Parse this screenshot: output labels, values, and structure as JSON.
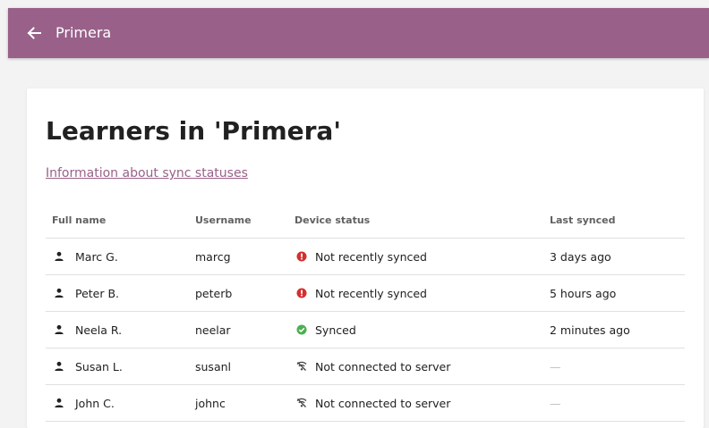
{
  "appbar": {
    "title": "Primera",
    "background": "#996189",
    "back_icon": "arrow-left-icon"
  },
  "page": {
    "title": "Learners in 'Primera'",
    "info_link": "Information about sync statuses"
  },
  "table": {
    "headers": [
      "Full name",
      "Username",
      "Device status",
      "Last synced"
    ],
    "rows": [
      {
        "full_name": "Marc G.",
        "username": "marcg",
        "status": "Not recently synced",
        "status_icon": "error-icon",
        "last_synced": "3 days ago"
      },
      {
        "full_name": "Peter B.",
        "username": "peterb",
        "status": "Not recently synced",
        "status_icon": "error-icon",
        "last_synced": "5 hours ago"
      },
      {
        "full_name": "Neela R.",
        "username": "neelar",
        "status": "Synced",
        "status_icon": "check-circle-icon",
        "last_synced": "2 minutes ago"
      },
      {
        "full_name": "Susan L.",
        "username": "susanl",
        "status": "Not connected to server",
        "status_icon": "no-connection-icon",
        "last_synced": "—"
      },
      {
        "full_name": "John C.",
        "username": "johnc",
        "status": "Not connected to server",
        "status_icon": "no-connection-icon",
        "last_synced": "—"
      }
    ]
  },
  "colors": {
    "error": "#d32f2f",
    "success": "#4caf50",
    "link": "#996189"
  }
}
